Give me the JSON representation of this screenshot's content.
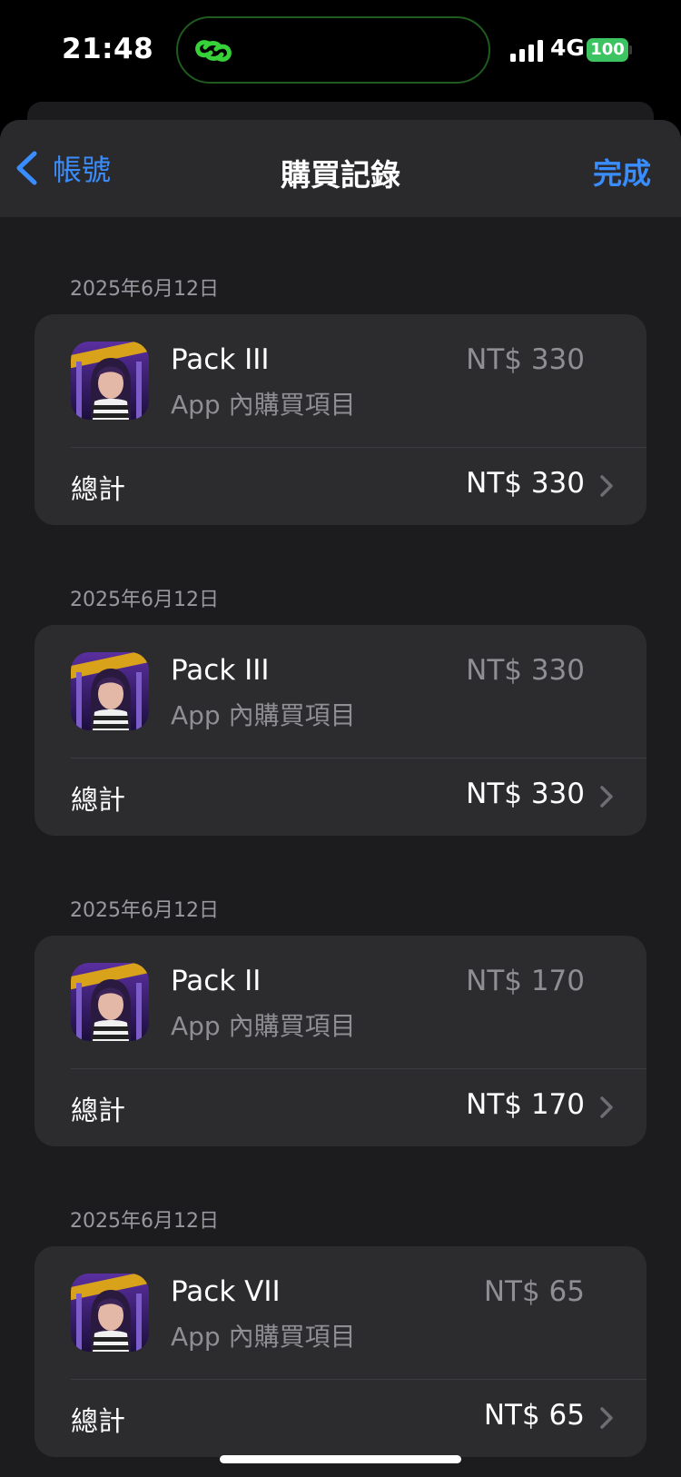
{
  "status": {
    "time": "21:48",
    "network": "4G",
    "battery": "100"
  },
  "nav": {
    "back_label": "帳號",
    "title": "購買記錄",
    "done_label": "完成"
  },
  "purchases": [
    {
      "date": "2025年6月12日",
      "name": "Pack III",
      "type": "App 內購買項目",
      "price": "NT$ 330",
      "total_label": "總計",
      "total": "NT$ 330"
    },
    {
      "date": "2025年6月12日",
      "name": "Pack III",
      "type": "App 內購買項目",
      "price": "NT$ 330",
      "total_label": "總計",
      "total": "NT$ 330"
    },
    {
      "date": "2025年6月12日",
      "name": "Pack II",
      "type": "App 內購買項目",
      "price": "NT$ 170",
      "total_label": "總計",
      "total": "NT$ 170"
    },
    {
      "date": "2025年6月12日",
      "name": "Pack VII",
      "type": "App 內購買項目",
      "price": "NT$ 65",
      "total_label": "總計",
      "total": "NT$ 65"
    }
  ],
  "colors": {
    "accent": "#3a8dff",
    "battery": "#3cc463",
    "card": "#2c2c2e",
    "background": "#1c1c1e"
  }
}
